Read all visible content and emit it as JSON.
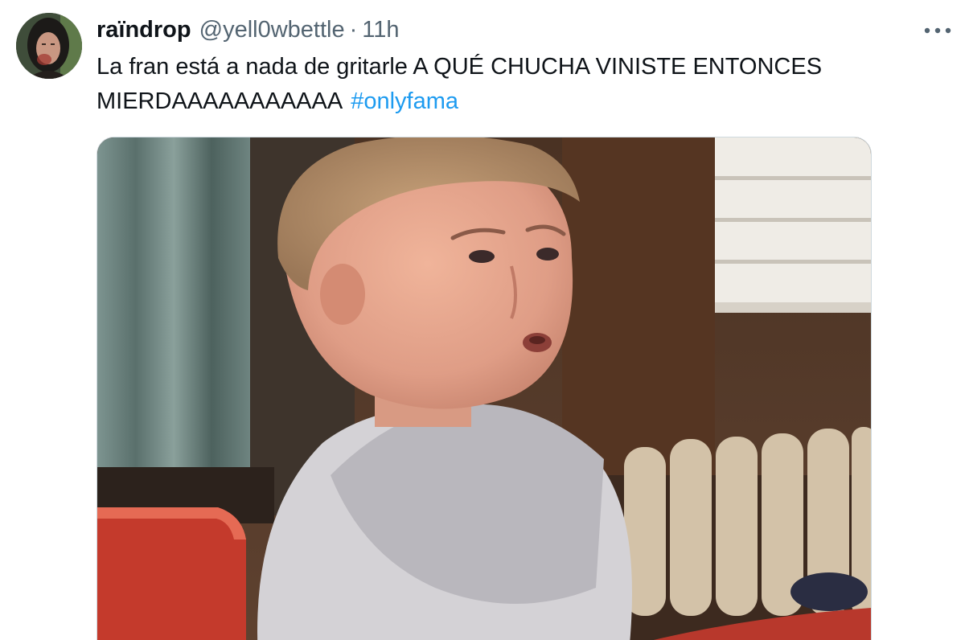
{
  "tweet": {
    "display_name": "raïndrop",
    "handle": "@yell0wbettle",
    "separator": "·",
    "time": "11h",
    "text_line_1": "La fran está a nada de gritarle A QUÉ CHUCHA VINISTE ENTONCES",
    "text_line_2": "MIERDAAAAAAAAAAA",
    "hashtag": "#onlyfama",
    "more_icon": "more-horizontal-icon",
    "avatar_icon": "user-avatar",
    "media": "photo"
  },
  "colors": {
    "text_primary": "#0f1419",
    "text_secondary": "#536471",
    "link": "#1d9bf0",
    "border": "#cfd9de"
  }
}
